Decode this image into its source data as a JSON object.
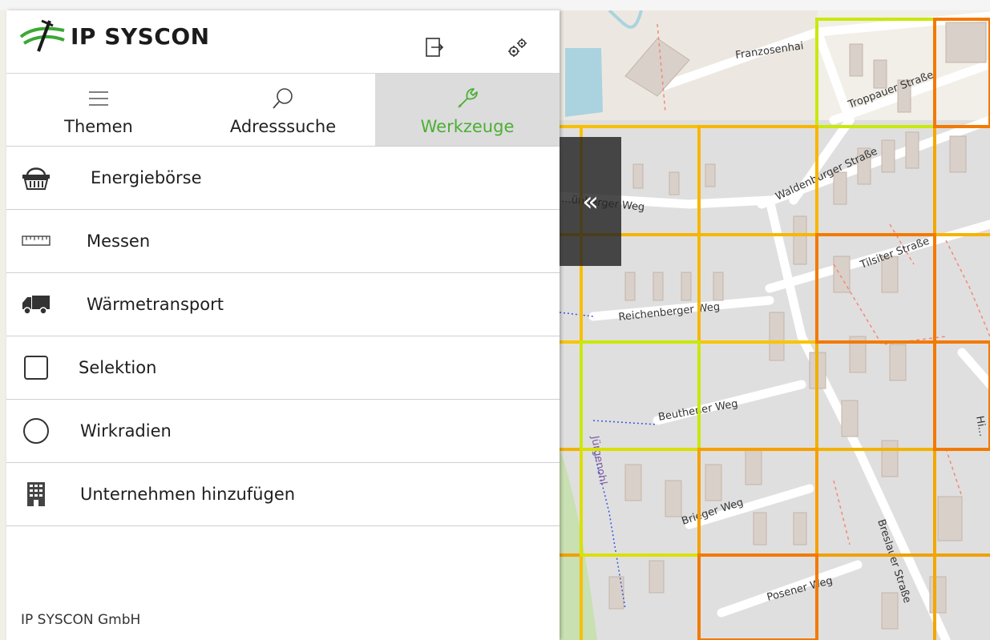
{
  "brand": {
    "name": "IP SYSCON",
    "footer": "IP SYSCON GmbH"
  },
  "header": {
    "logout_icon": "logout-icon",
    "settings_icon": "gears-icon"
  },
  "tabs": [
    {
      "label": "Themen",
      "icon": "menu-icon",
      "active": false
    },
    {
      "label": "Adresssuche",
      "icon": "search-icon",
      "active": false
    },
    {
      "label": "Werkzeuge",
      "icon": "wrench-icon",
      "active": true
    }
  ],
  "tools": [
    {
      "label": "Energiebörse",
      "icon": "basket-icon"
    },
    {
      "label": "Messen",
      "icon": "ruler-icon"
    },
    {
      "label": "Wärmetransport",
      "icon": "truck-icon"
    },
    {
      "label": "Selektion",
      "icon": "square-icon"
    },
    {
      "label": "Wirkradien",
      "icon": "circle-icon"
    },
    {
      "label": "Unternehmen hinzufügen",
      "icon": "building-icon"
    }
  ],
  "collapse_glyph": "«",
  "map": {
    "street_labels": [
      "Franzosenhai",
      "Troppauer Straße",
      "Waldenburger Straße",
      "...ünberger Weg",
      "Tilsiter Straße",
      "Reichenberger Weg",
      "Beuthener Weg",
      "Jürgenohl",
      "Brieger Weg",
      "Breslauer Straße",
      "Posener Weg",
      "Hi..."
    ]
  },
  "colors": {
    "accent_green": "#4caf34",
    "logo_green": "#3aa935",
    "grid_yellow": "#c9e80c",
    "grid_orange": "#f7a800",
    "grid_red_orange": "#f27a00"
  }
}
